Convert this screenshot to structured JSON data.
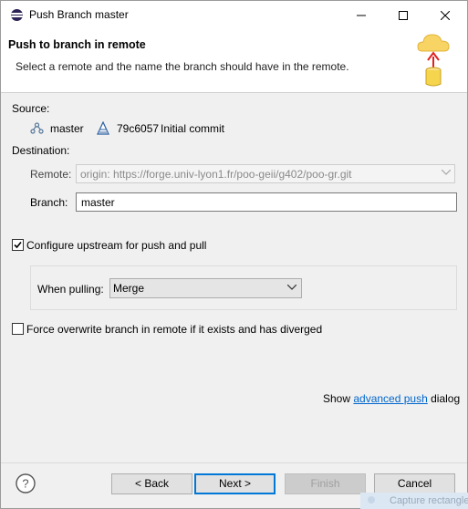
{
  "window": {
    "title": "Push Branch master"
  },
  "banner": {
    "title": "Push to branch in remote",
    "description": "Select a remote and the name the branch should have in the remote."
  },
  "source": {
    "label": "Source:",
    "branch": "master",
    "commit_id": "79c6057",
    "commit_message": "Initial commit"
  },
  "destination": {
    "label": "Destination:",
    "remote_label": "Remote:",
    "remote_value": "origin: https://forge.univ-lyon1.fr/poo-geii/g402/poo-gr.git",
    "branch_label": "Branch:",
    "branch_value": "master"
  },
  "upstream": {
    "label": "Configure upstream for push and pull",
    "checked": true,
    "pulling_label": "When pulling:",
    "pulling_value": "Merge"
  },
  "force": {
    "label": "Force overwrite branch in remote if it exists and has diverged",
    "checked": false
  },
  "advanced": {
    "prefix": "Show ",
    "link": "advanced push",
    "suffix": " dialog"
  },
  "buttons": {
    "back": "< Back",
    "next": "Next >",
    "finish": "Finish",
    "cancel": "Cancel"
  },
  "overlay": {
    "capture_label": "Capture rectangle"
  },
  "icons": {
    "app": "eclipse-icon",
    "branch": "branch-icon",
    "commit": "commit-icon",
    "help": "help-icon",
    "banner": "push-cloud-icon"
  }
}
